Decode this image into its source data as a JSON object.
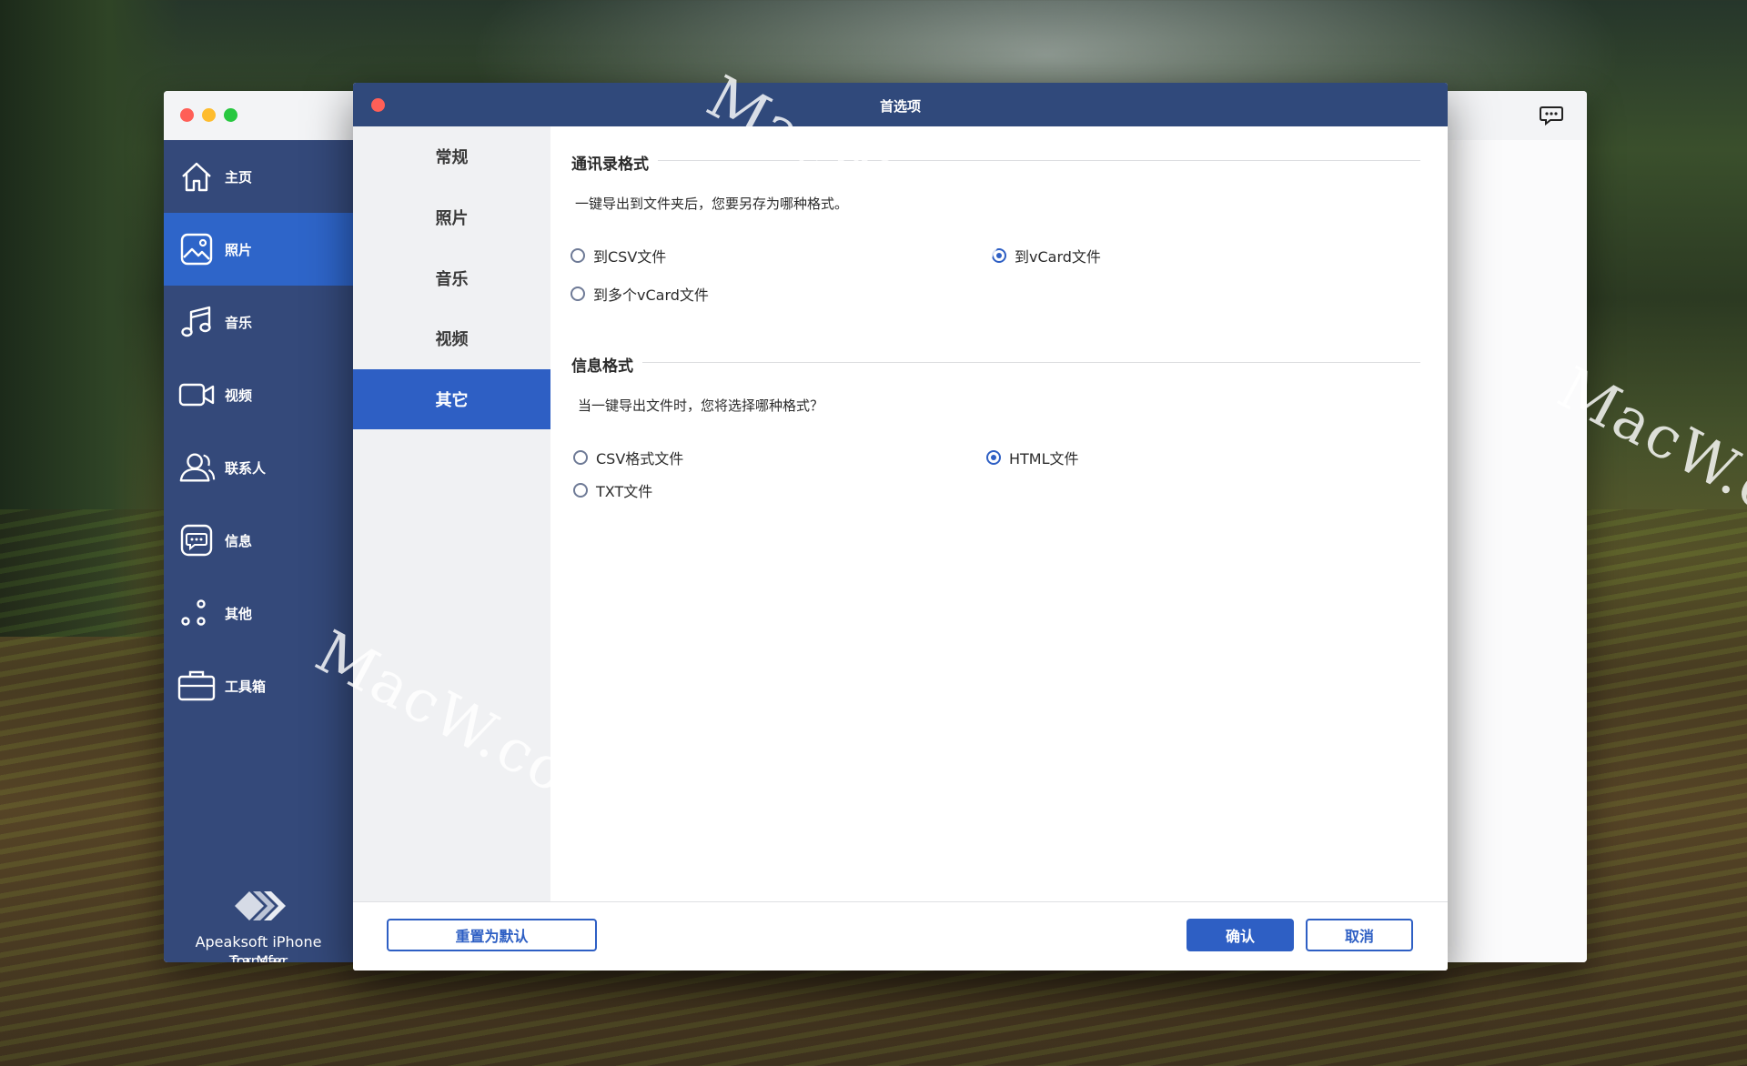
{
  "watermark": "MacW.com",
  "main_window": {
    "sidebar": {
      "items": [
        {
          "label": "主页",
          "icon": "home-icon"
        },
        {
          "label": "照片",
          "icon": "photo-icon",
          "active": true
        },
        {
          "label": "音乐",
          "icon": "music-icon"
        },
        {
          "label": "视频",
          "icon": "video-icon"
        },
        {
          "label": "联系人",
          "icon": "contacts-icon"
        },
        {
          "label": "信息",
          "icon": "message-icon"
        },
        {
          "label": "其他",
          "icon": "other-icon"
        },
        {
          "label": "工具箱",
          "icon": "toolbox-icon"
        }
      ],
      "brand_line1": "Apeaksoft iPhone Transfer",
      "brand_line2": "for Mac"
    }
  },
  "dialog": {
    "title": "首选项",
    "tabs": [
      {
        "label": "常规"
      },
      {
        "label": "照片"
      },
      {
        "label": "音乐"
      },
      {
        "label": "视频"
      },
      {
        "label": "其它",
        "active": true
      }
    ],
    "contacts_section": {
      "title": "通讯录格式",
      "description": "一键导出到文件夹后，您要另存为哪种格式。",
      "options": [
        {
          "label": "到CSV文件",
          "checked": false
        },
        {
          "label": "到vCard文件",
          "checked": true
        },
        {
          "label": "到多个vCard文件",
          "checked": false
        }
      ]
    },
    "messages_section": {
      "title": "信息格式",
      "description": "当一键导出文件时，您将选择哪种格式？",
      "options": [
        {
          "label": "CSV格式文件",
          "checked": false
        },
        {
          "label": "HTML文件",
          "checked": true
        },
        {
          "label": "TXT文件",
          "checked": false
        }
      ]
    },
    "footer": {
      "reset_label": "重置为默认",
      "confirm_label": "确认",
      "cancel_label": "取消"
    }
  },
  "colors": {
    "sidebar_bg": "#34497a",
    "accent": "#2e5fc4",
    "dialog_titlebar": "#30497b"
  }
}
